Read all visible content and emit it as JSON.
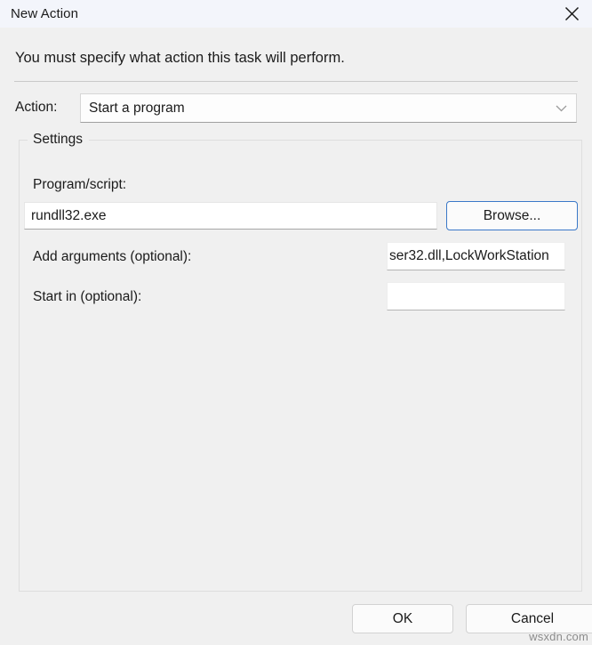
{
  "window": {
    "title": "New Action",
    "close_icon": "close-icon"
  },
  "instruction": "You must specify what action this task will perform.",
  "action_row": {
    "label": "Action:",
    "selected": "Start a program",
    "chevron_icon": "chevron-down-icon"
  },
  "settings": {
    "legend": "Settings",
    "program": {
      "label": "Program/script:",
      "value": "rundll32.exe",
      "placeholder": ""
    },
    "browse_button": "Browse...",
    "arguments": {
      "label": "Add arguments (optional):",
      "value": "ser32.dll,LockWorkStation",
      "placeholder": ""
    },
    "start_in": {
      "label": "Start in (optional):",
      "value": "",
      "placeholder": ""
    }
  },
  "footer": {
    "ok": "OK",
    "cancel": "Cancel"
  },
  "watermark": "wsxdn.com",
  "colors": {
    "titlebar_bg": "#f3f5fb",
    "dialog_bg": "#f0f0f0",
    "accent_focus_border": "#3a78c8",
    "text": "#1b1b1b",
    "groupbox_border": "#dedede"
  }
}
